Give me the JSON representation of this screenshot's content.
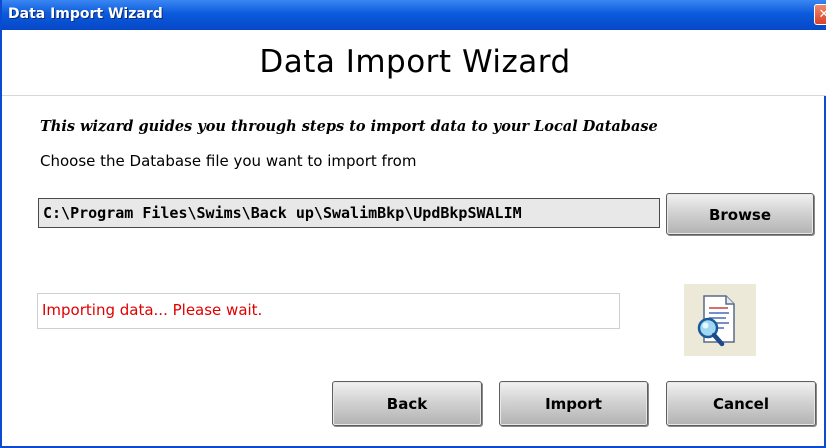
{
  "window": {
    "title": "Data Import Wizard",
    "close_label": "✕"
  },
  "header": {
    "heading": "Data Import Wizard"
  },
  "main": {
    "intro": "This wizard guides you through steps to import data to your Local Database",
    "prompt": "Choose the Database file you want to import from",
    "file_path": "C:\\Program Files\\Swims\\Back up\\SwalimBkp\\UpdBkpSWALIM",
    "browse_label": "Browse",
    "status_text": "Importing data... Please wait.",
    "status_color": "#e00000",
    "status_icon": "document-search-icon"
  },
  "footer": {
    "back_label": "Back",
    "import_label": "Import",
    "cancel_label": "Cancel"
  },
  "colors": {
    "titlebar": "#0b5bdc",
    "button_face": "#c8c8c8"
  }
}
